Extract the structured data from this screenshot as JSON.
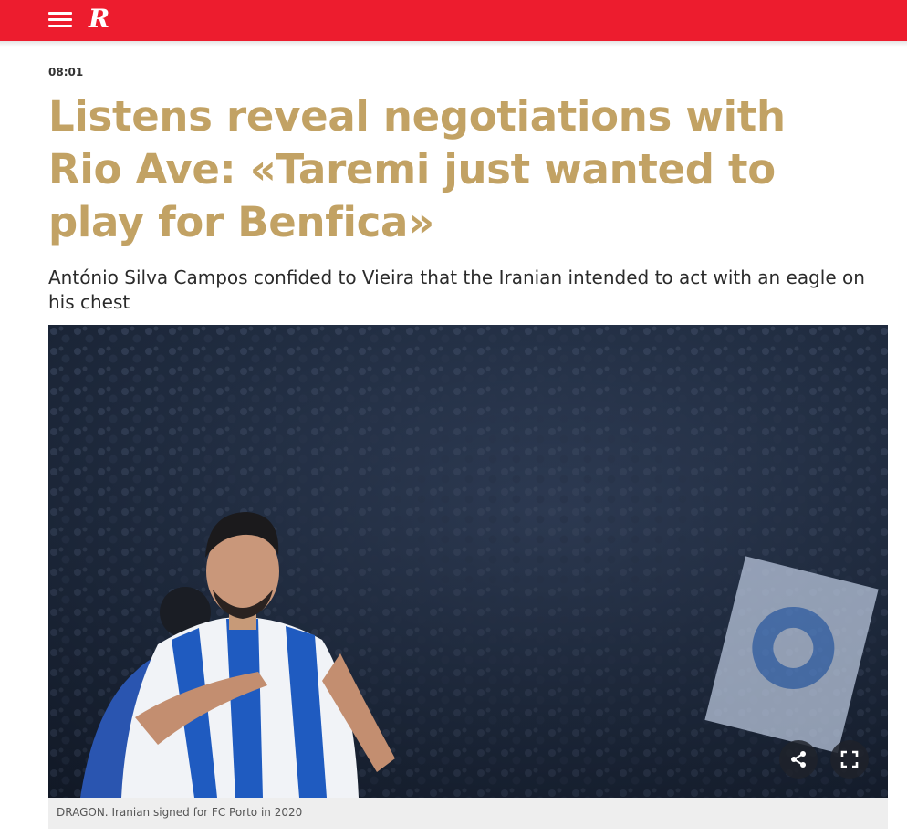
{
  "header": {
    "logo_text": "R",
    "menu_icon": "hamburger-menu-icon",
    "brand_color": "#ed1c2e"
  },
  "article": {
    "time": "08:01",
    "headline": "Listens reveal negotiations with Rio Ave: «Taremi just wanted to play for Benfica»",
    "lead": "António Silva Campos confided to Vieira that the Iranian intended to act with an eagle on his chest",
    "headline_color": "#c2a264"
  },
  "photo": {
    "share_icon": "share-icon",
    "fullscreen_icon": "fullscreen-icon",
    "caption": "DRAGON. Iranian signed for FC Porto in 2020"
  }
}
